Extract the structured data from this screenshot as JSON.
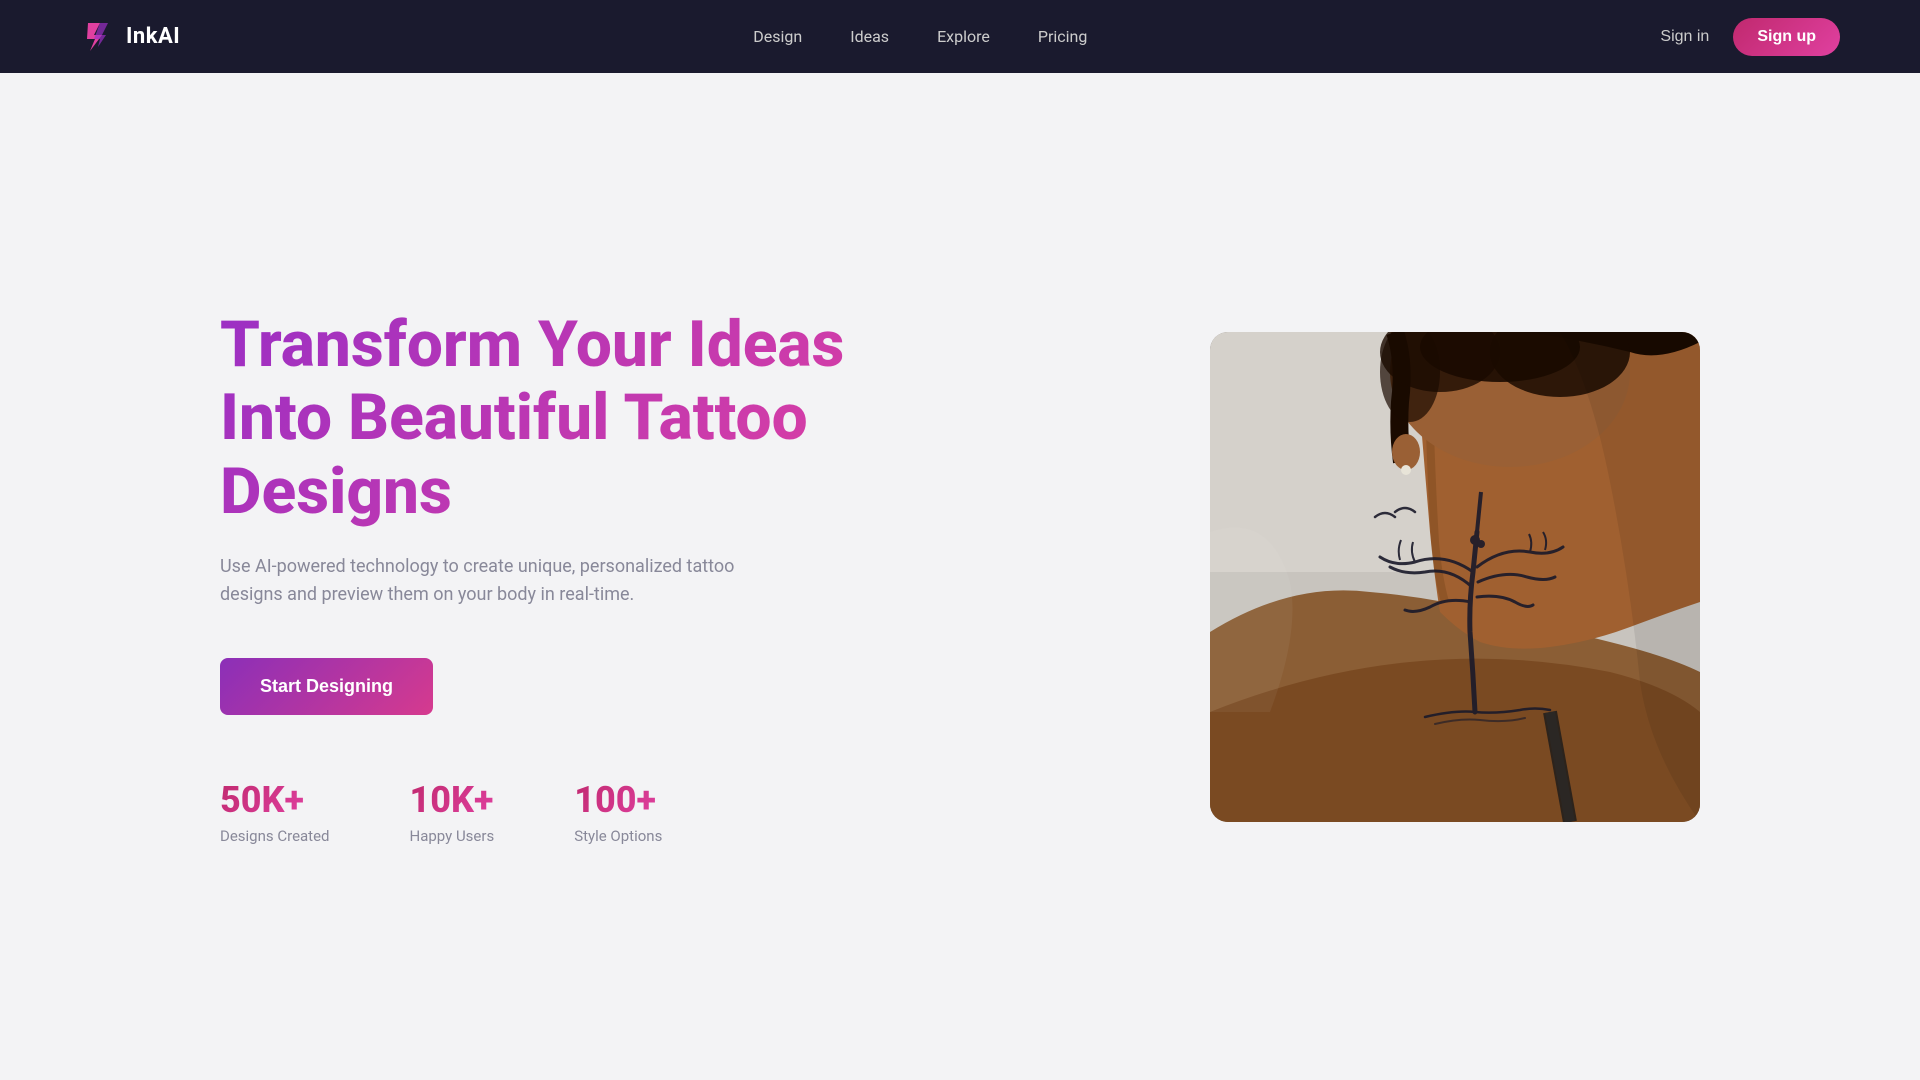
{
  "navbar": {
    "logo_text": "InkAI",
    "links": [
      {
        "label": "Design",
        "id": "design"
      },
      {
        "label": "Ideas",
        "id": "ideas"
      },
      {
        "label": "Explore",
        "id": "explore"
      },
      {
        "label": "Pricing",
        "id": "pricing"
      }
    ],
    "sign_in_label": "Sign in",
    "sign_up_label": "Sign up"
  },
  "hero": {
    "title": "Transform Your Ideas Into Beautiful Tattoo Designs",
    "subtitle": "Use AI-powered technology to create unique, personalized tattoo designs and preview them on your body in real-time.",
    "cta_label": "Start Designing",
    "stats": [
      {
        "number": "50K+",
        "label": "Designs Created"
      },
      {
        "number": "10K+",
        "label": "Happy Users"
      },
      {
        "number": "100+",
        "label": "Style Options"
      }
    ]
  },
  "colors": {
    "brand_gradient_start": "#9b2fc4",
    "brand_gradient_end": "#e040a0",
    "navbar_bg": "#1a1a2e",
    "page_bg": "#f3f3f5",
    "text_muted": "#888899"
  }
}
